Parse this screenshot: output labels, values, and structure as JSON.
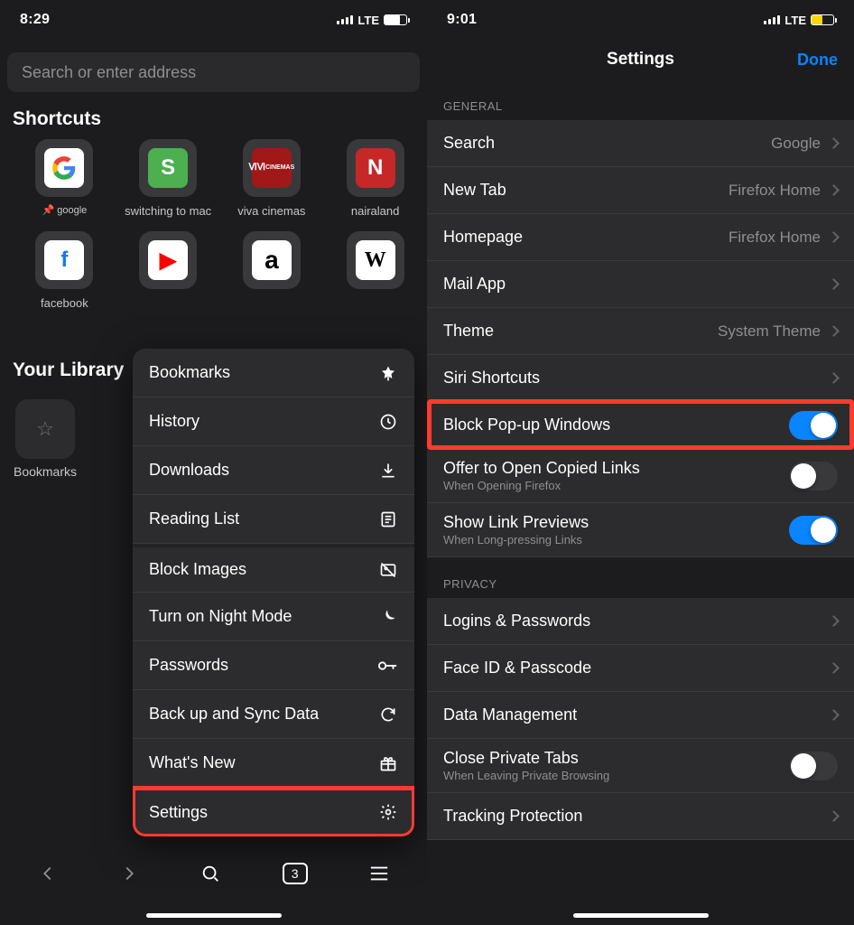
{
  "left": {
    "status": {
      "time": "8:29",
      "network": "LTE",
      "battery_color": "white"
    },
    "search_placeholder": "Search or enter address",
    "shortcuts_title": "Shortcuts",
    "shortcuts_row1": [
      {
        "label": "google",
        "pinned": true
      },
      {
        "label": "switching to mac"
      },
      {
        "label": "viva cinemas"
      },
      {
        "label": "nairaland"
      }
    ],
    "shortcuts_row2": [
      {
        "label": "facebook"
      }
    ],
    "library_title": "Your Library",
    "library_items": [
      {
        "label": "Bookmarks"
      }
    ],
    "menu": [
      {
        "label": "Bookmarks",
        "icon": "star-icon"
      },
      {
        "label": "History",
        "icon": "clock-icon"
      },
      {
        "label": "Downloads",
        "icon": "download-icon"
      },
      {
        "label": "Reading List",
        "icon": "reading-list-icon"
      },
      {
        "label": "Block Images",
        "icon": "no-image-icon",
        "group_sep": true
      },
      {
        "label": "Turn on Night Mode",
        "icon": "moon-icon"
      },
      {
        "label": "Passwords",
        "icon": "key-icon"
      },
      {
        "label": "Back up and Sync Data",
        "icon": "sync-icon"
      },
      {
        "label": "What's New",
        "icon": "gift-icon"
      },
      {
        "label": "Settings",
        "icon": "gear-icon",
        "highlight": true
      }
    ],
    "tab_count": "3"
  },
  "right": {
    "status": {
      "time": "9:01",
      "network": "LTE",
      "battery_color": "yellow"
    },
    "nav_title": "Settings",
    "nav_done": "Done",
    "groups": [
      {
        "header": "GENERAL",
        "rows": [
          {
            "label": "Search",
            "value": "Google",
            "type": "chevron"
          },
          {
            "label": "New Tab",
            "value": "Firefox Home",
            "type": "chevron"
          },
          {
            "label": "Homepage",
            "value": "Firefox Home",
            "type": "chevron"
          },
          {
            "label": "Mail App",
            "type": "chevron"
          },
          {
            "label": "Theme",
            "value": "System Theme",
            "type": "chevron"
          },
          {
            "label": "Siri Shortcuts",
            "type": "chevron"
          },
          {
            "label": "Block Pop-up Windows",
            "type": "toggle",
            "on": true,
            "highlight": true
          },
          {
            "label": "Offer to Open Copied Links",
            "sub": "When Opening Firefox",
            "type": "toggle",
            "on": false
          },
          {
            "label": "Show Link Previews",
            "sub": "When Long-pressing Links",
            "type": "toggle",
            "on": true
          }
        ]
      },
      {
        "header": "PRIVACY",
        "rows": [
          {
            "label": "Logins & Passwords",
            "type": "chevron"
          },
          {
            "label": "Face ID & Passcode",
            "type": "chevron"
          },
          {
            "label": "Data Management",
            "type": "chevron"
          },
          {
            "label": "Close Private Tabs",
            "sub": "When Leaving Private Browsing",
            "type": "toggle",
            "on": false
          },
          {
            "label": "Tracking Protection",
            "type": "chevron"
          }
        ]
      }
    ]
  }
}
